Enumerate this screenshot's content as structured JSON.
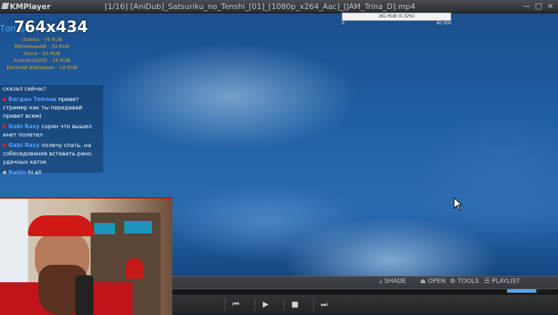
{
  "window": {
    "app_name": "KMPlayer",
    "file_title": "[1/16] [AniDub]_Satsuriku_no_Tenshi_[01]_[1080p_x264_Aac]_[JAM_Trina_D].mp4",
    "minimize_label": "—",
    "maximize_label": "□",
    "close_label": "×"
  },
  "overlay": {
    "resolution": "764x434",
    "top_label": "Топ донатеров мес",
    "donation": {
      "text": "261 RUB (0.32%)",
      "progress_percent": 0.32,
      "min_label": "0",
      "max_label": "80 000"
    },
    "donors": [
      "cbanka - 76 RUB",
      "88Неймик88 - 50 RUB",
      "Shura - 50 RUB",
      "Andrekai2005 - 15 RUB",
      "Евгений Шипицын - 10 RUB"
    ]
  },
  "chat": {
    "messages": [
      {
        "user": "",
        "text": "сказал сейчас!",
        "dot": "none"
      },
      {
        "user": "Богдан Теплов",
        "text": "привет стример как ты передавай привет всем)",
        "dot": "red"
      },
      {
        "user": "Gabi Rasy",
        "text": "сорян что вышел инет полетел",
        "dot": "red"
      },
      {
        "user": "Gabi Rasy",
        "text": "полечу спать. на собеседование вставать рано. удачных каток",
        "dot": "red"
      },
      {
        "user": "Raido",
        "text": "hi all",
        "dot": "gray"
      }
    ]
  },
  "controls": {
    "shade_label": "SHADE",
    "open_label": "OPEN",
    "tools_label": "TOOLS",
    "playlist_label": "PLAYLIST",
    "prev_label": "⏮",
    "play_label": "▶",
    "stop_label": "■",
    "next_label": "⏭",
    "volume_percent": 70
  },
  "colors": {
    "accent": "#5aa5e8",
    "donor_text": "#e3a21a",
    "chat_user": "#5aa0ff"
  }
}
